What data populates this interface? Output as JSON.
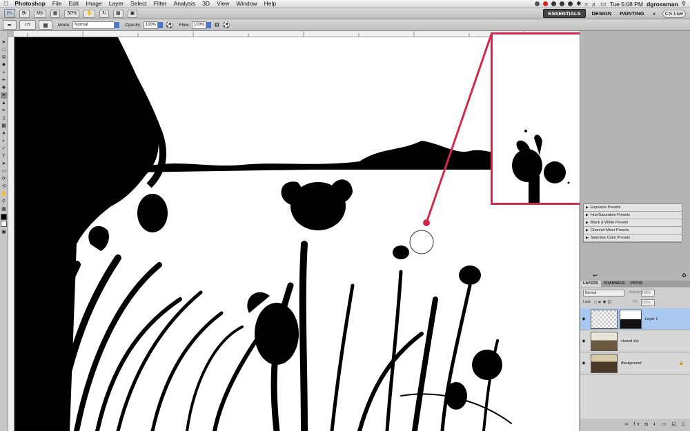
{
  "menubar": {
    "apple": "",
    "app": "Photoshop",
    "items": [
      "File",
      "Edit",
      "Image",
      "Layer",
      "Select",
      "Filter",
      "Analysis",
      "3D",
      "View",
      "Window",
      "Help"
    ],
    "clock": "Tue 5:08 PM",
    "user": "dgrossman"
  },
  "appbar": {
    "logo": "Ps",
    "zoom": "50%",
    "workspaces": [
      "ESSENTIALS",
      "DESIGN",
      "PAINTING"
    ],
    "more": "»",
    "cslive": "CS Live"
  },
  "options": {
    "brush_size": "175",
    "mode_label": "Mode:",
    "mode_value": "Normal",
    "opacity_label": "Opacity:",
    "opacity_value": "100%",
    "flow_label": "Flow:",
    "flow_value": "100%"
  },
  "presets": [
    "Exposure Presets",
    "Hue/Saturation Presets",
    "Black & White Presets",
    "Channel Mixer Presets",
    "Selective Color Presets"
  ],
  "layers_panel": {
    "tabs": [
      "LAYERS",
      "CHANNELS",
      "PATHS"
    ],
    "blend_mode": "Normal",
    "opacity_label": "Opacity:",
    "opacity_value": "100%",
    "lock_label": "Lock:",
    "fill_label": "Fill:",
    "fill_value": "100%",
    "layers": [
      {
        "name": "Layer 1"
      },
      {
        "name": "cloned sky"
      },
      {
        "name": "Background"
      }
    ],
    "footer_icons": "∞ fx ◘ ◐ ▭ ◱ ▯"
  },
  "colors": {
    "callout": "#d3284a",
    "selected_layer": "#a9c8f0",
    "active_workspace": "#444444"
  }
}
